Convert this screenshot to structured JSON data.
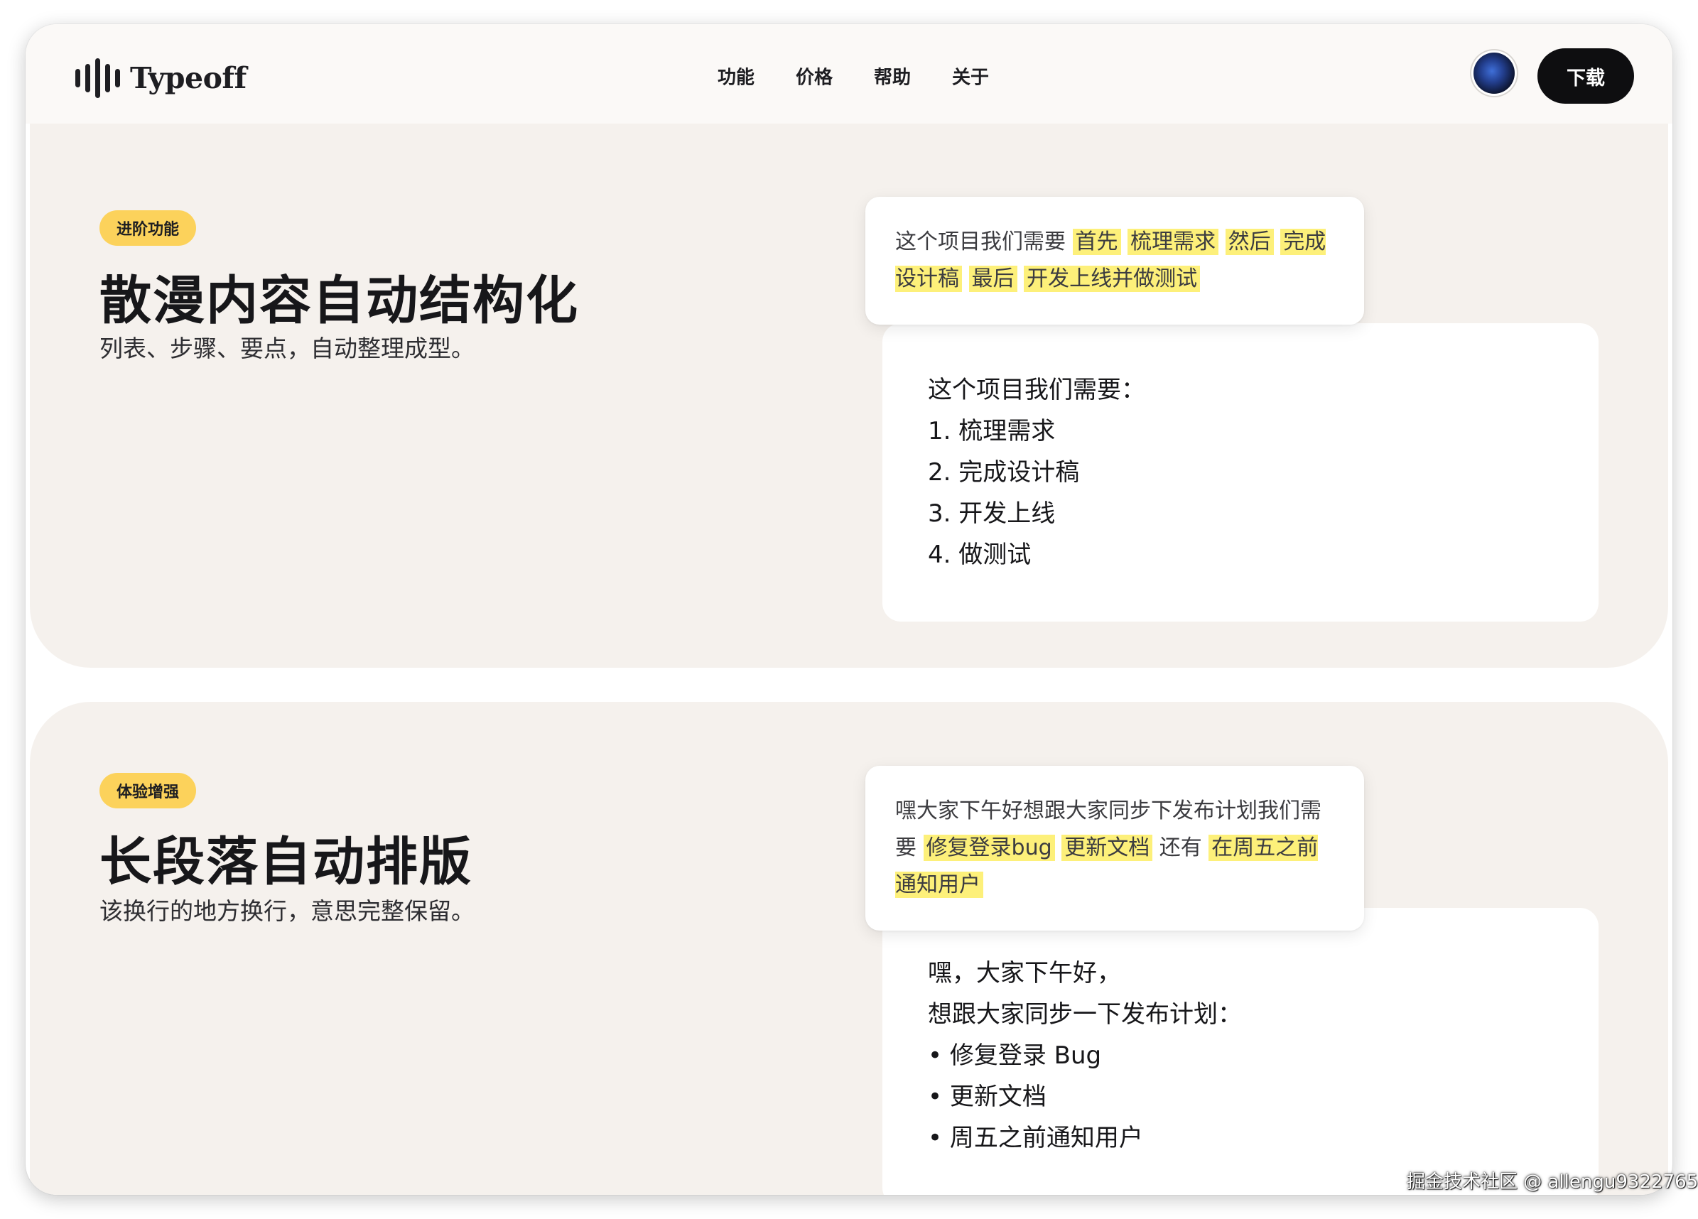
{
  "app": {
    "brand": "Typeoff"
  },
  "nav": {
    "items": [
      "功能",
      "价格",
      "帮助",
      "关于"
    ]
  },
  "header": {
    "download_label": "下载"
  },
  "sections": [
    {
      "badge": "进阶功能",
      "title": "散漫内容自动结构化",
      "subtitle": "列表、步骤、要点，自动整理成型。",
      "input_segments": [
        {
          "text": "这个项目我们需要",
          "highlight": false
        },
        {
          "text": "首先",
          "highlight": true
        },
        {
          "text": "梳理需求",
          "highlight": true
        },
        {
          "text": "然后",
          "highlight": true
        },
        {
          "text": "完成设计稿",
          "highlight": true
        },
        {
          "text": "最后",
          "highlight": true
        },
        {
          "text": "开发上线并做测试",
          "highlight": true
        }
      ],
      "output_lines": [
        "这个项目我们需要：",
        "1. 梳理需求",
        "2. 完成设计稿",
        "3. 开发上线",
        "4. 做测试"
      ]
    },
    {
      "badge": "体验增强",
      "title": "长段落自动排版",
      "subtitle": "该换行的地方换行，意思完整保留。",
      "input_segments": [
        {
          "text": "嘿大家下午好想跟大家同步下发布计划我们需要",
          "highlight": false
        },
        {
          "text": "修复登录bug",
          "highlight": true
        },
        {
          "text": "更新文档",
          "highlight": true
        },
        {
          "text": "还有",
          "highlight": false
        },
        {
          "text": "在周五之前通知用户",
          "highlight": true
        }
      ],
      "output_lines": [
        "嘿，大家下午好，",
        "想跟大家同步一下发布计划：",
        "• 修复登录 Bug",
        "• 更新文档",
        "• 周五之前通知用户"
      ]
    }
  ],
  "watermark": "掘金技术社区 @ allengu9322765",
  "colors": {
    "badge": "#fcd25b",
    "highlight": "#fdf07a",
    "section_bg": "#f5f1ed",
    "button": "#0e0e10"
  }
}
